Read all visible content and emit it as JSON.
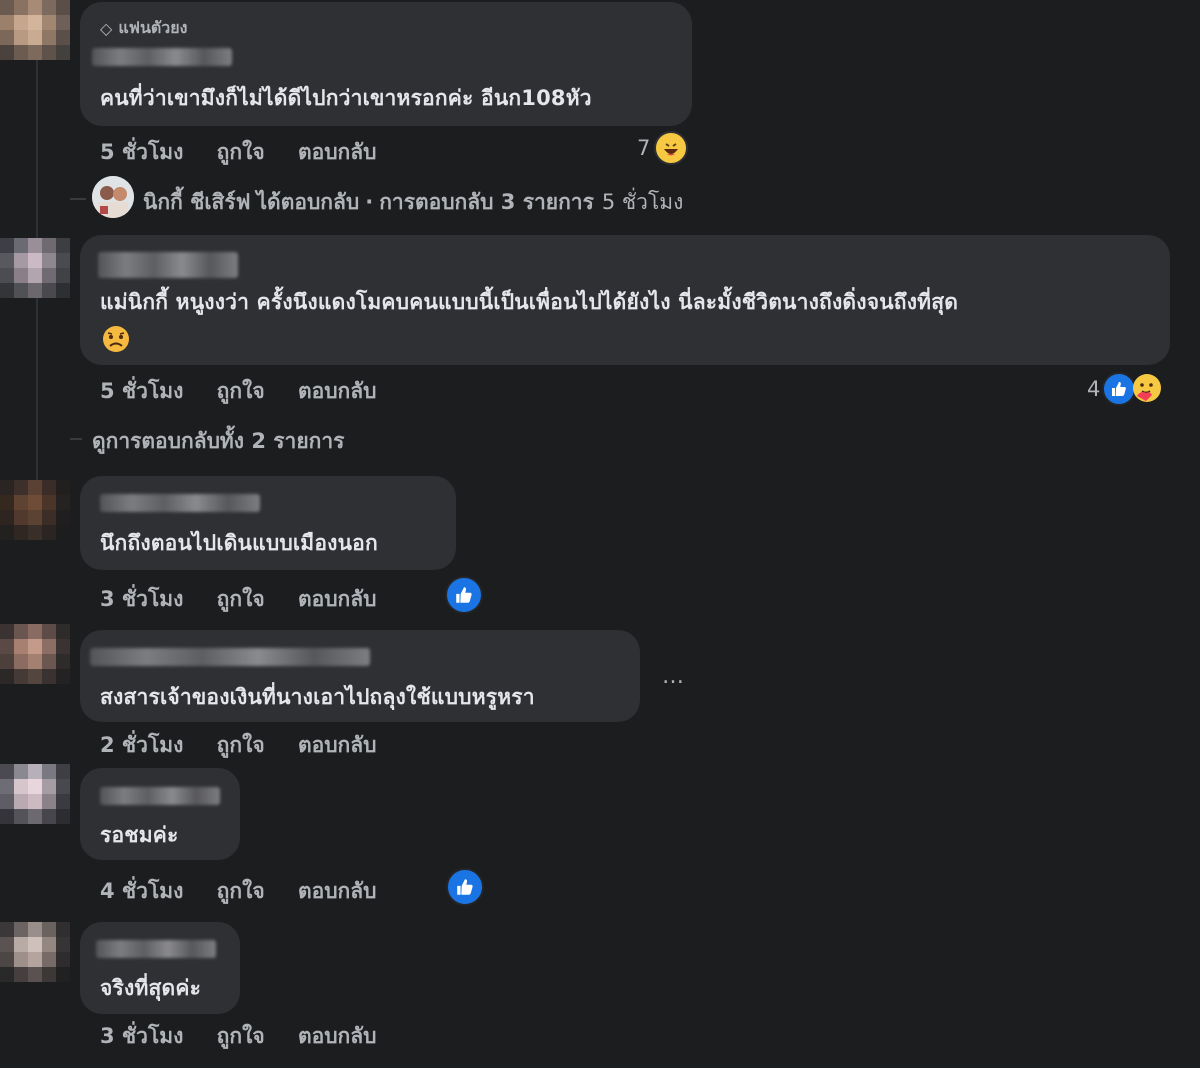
{
  "comments": [
    {
      "badge": "แฟนตัวยง",
      "text": "คนที่ว่าเขามึงก็ไม่ได้ดีไปกว่าเขาหรอกค่ะ อีนก108หัว",
      "time": "5 ชั่วโมง",
      "like": "ถูกใจ",
      "reply": "ตอบกลับ",
      "reaction_count": "7",
      "reactions": [
        "laugh-icon"
      ]
    },
    {
      "text": "แม่นิกกี้ หนูงงว่า ครั้งนึงแดงโมคบคนแบบนี้เป็นเพื่อนไปได้ยังไง นี่ละมั้งชีวิตนางถึงดิ่งจนถึงที่สุด",
      "time": "5 ชั่วโมง",
      "like": "ถูกใจ",
      "reply": "ตอบกลับ",
      "reaction_count": "4",
      "reactions": [
        "like-icon",
        "care-icon"
      ],
      "view_replies": "ดูการตอบกลับทั้ง 2 รายการ"
    },
    {
      "text": "นึกถึงตอนไปเดินแบบเมืองนอก",
      "time": "3 ชั่วโมง",
      "like": "ถูกใจ",
      "reply": "ตอบกลับ",
      "reactions": [
        "like-icon"
      ]
    },
    {
      "text": "สงสารเจ้าของเงินที่นางเอาไปถลุงใช้แบบหรูหรา",
      "time": "2 ชั่วโมง",
      "like": "ถูกใจ",
      "reply": "ตอบกลับ",
      "more": "…"
    },
    {
      "text": "รอชมค่ะ",
      "time": "4 ชั่วโมง",
      "like": "ถูกใจ",
      "reply": "ตอบกลับ",
      "reactions": [
        "like-icon"
      ]
    },
    {
      "text": "จริงที่สุดค่ะ",
      "time": "3 ชั่วโมง",
      "like": "ถูกใจ",
      "reply": "ตอบกลับ"
    }
  ],
  "reply_summary": {
    "name": "นิกกี้ ชีเสิร์ฟ",
    "action": "ได้ตอบกลับ",
    "sep": "·",
    "count": "การตอบกลับ 3 รายการ",
    "time": "5 ชั่วโมง"
  },
  "colors": {
    "background": "#1c1d1f",
    "bubble": "#2f3033",
    "like_blue": "#1b74e4",
    "meta": "#b0b3b8"
  }
}
